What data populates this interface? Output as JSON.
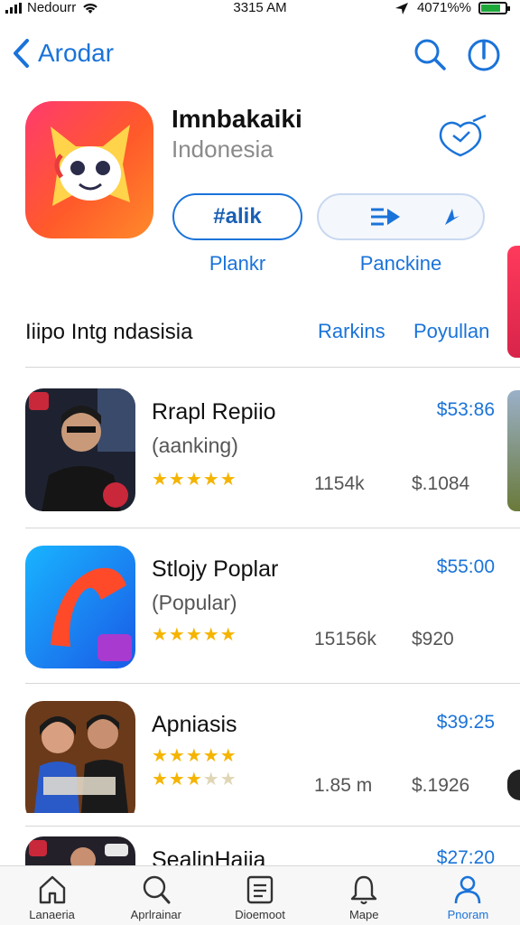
{
  "status_bar": {
    "carrier": "Nedourr",
    "time": "3315 AM",
    "battery_text": "4071%%",
    "battery_level": 0.8
  },
  "nav": {
    "back_label": "Arodar",
    "icons": [
      "chevron-left-icon",
      "search-icon",
      "info-icon"
    ]
  },
  "app": {
    "title": "Imnbakaiki",
    "subtitle": "Indonesia",
    "button_primary": "#alik",
    "button_primary_caption": "Plankr",
    "button_secondary_caption": "Panckine",
    "colors": {
      "accent": "#1a73d9",
      "star": "#f5b400"
    }
  },
  "section": {
    "title": "Iiipo Intg ndasisia",
    "links": [
      "Rarkins",
      "Poyullan"
    ]
  },
  "rows": [
    {
      "title": "Rrapl Repiio",
      "subtitle": "(aanking)",
      "price": "$53:86",
      "count": "1154k",
      "size": "$.1084",
      "rating": 5
    },
    {
      "title": "Stlojy Poplar",
      "subtitle": "(Popular)",
      "price": "$55:00",
      "count": "15156k",
      "size": "$920",
      "rating": 5
    },
    {
      "title": "Apniasis",
      "subtitle": "",
      "price": "$39:25",
      "count": "1.85 m",
      "size": "$.1926",
      "rating": 5,
      "rating2": 3
    },
    {
      "title": "SealinHaiia",
      "subtitle": "",
      "price": "$27:20",
      "count": "",
      "size": "",
      "rating": 0
    }
  ],
  "tabs": [
    {
      "label": "Lanaeria",
      "icon": "home-icon"
    },
    {
      "label": "Aprlrainar",
      "icon": "search-icon"
    },
    {
      "label": "Dioemoot",
      "icon": "list-icon"
    },
    {
      "label": "Mape",
      "icon": "bell-icon"
    },
    {
      "label": "Pnoram",
      "icon": "person-icon",
      "active": true
    }
  ]
}
